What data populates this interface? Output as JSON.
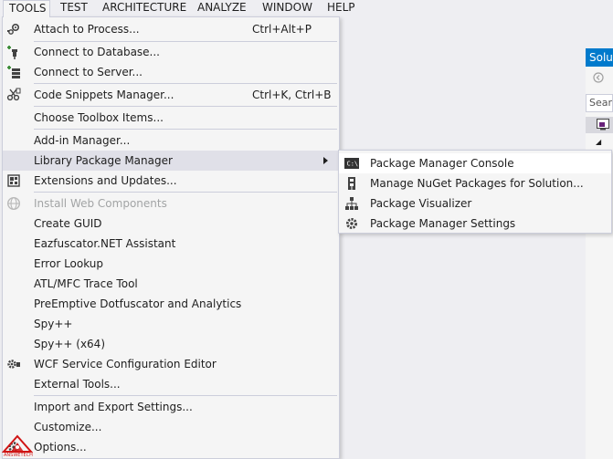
{
  "menubar": {
    "items": [
      {
        "label": "TOOLS"
      },
      {
        "label": "TEST"
      },
      {
        "label": "ARCHITECTURE"
      },
      {
        "label": "ANALYZE"
      },
      {
        "label": "WINDOW"
      },
      {
        "label": "HELP"
      }
    ]
  },
  "solution_explorer": {
    "title": "Solut",
    "search_placeholder": "Searc"
  },
  "tools_menu": {
    "items": [
      {
        "label": "Attach to Process...",
        "shortcut": "Ctrl+Alt+P",
        "icon": "attach-process-icon"
      },
      {
        "label": "Connect to Database...",
        "icon": "connect-database-icon"
      },
      {
        "label": "Connect to Server...",
        "icon": "connect-server-icon"
      },
      {
        "label": "Code Snippets Manager...",
        "shortcut": "Ctrl+K, Ctrl+B",
        "icon": "code-snippets-icon"
      },
      {
        "label": "Choose Toolbox Items..."
      },
      {
        "label": "Add-in Manager..."
      },
      {
        "label": "Library Package Manager",
        "has_submenu": true
      },
      {
        "label": "Extensions and Updates...",
        "icon": "extensions-icon"
      },
      {
        "label": "Install Web Components",
        "disabled": true,
        "icon": "web-components-icon"
      },
      {
        "label": "Create GUID"
      },
      {
        "label": "Eazfuscator.NET Assistant"
      },
      {
        "label": "Error Lookup"
      },
      {
        "label": "ATL/MFC Trace Tool"
      },
      {
        "label": "PreEmptive Dotfuscator and Analytics"
      },
      {
        "label": "Spy++"
      },
      {
        "label": "Spy++ (x64)"
      },
      {
        "label": "WCF Service Configuration Editor",
        "icon": "wcf-gear-icon"
      },
      {
        "label": "External Tools..."
      },
      {
        "label": "Import and Export Settings..."
      },
      {
        "label": "Customize..."
      },
      {
        "label": "Options...",
        "icon": "options-gear-icon"
      }
    ]
  },
  "package_submenu": {
    "items": [
      {
        "label": "Package Manager Console",
        "icon": "console-icon"
      },
      {
        "label": "Manage NuGet Packages for Solution...",
        "icon": "nuget-packages-icon"
      },
      {
        "label": "Package Visualizer",
        "icon": "hierarchy-icon"
      },
      {
        "label": "Package Manager Settings",
        "icon": "settings-gear-icon"
      }
    ]
  },
  "watermark": {
    "text": "ANSWETECH"
  },
  "colors": {
    "accent": "#007acc",
    "menu_bg": "#f5f5f5",
    "highlight": "#e0e0e8",
    "border": "#cccedb",
    "disabled_text": "#a2a4a5"
  }
}
